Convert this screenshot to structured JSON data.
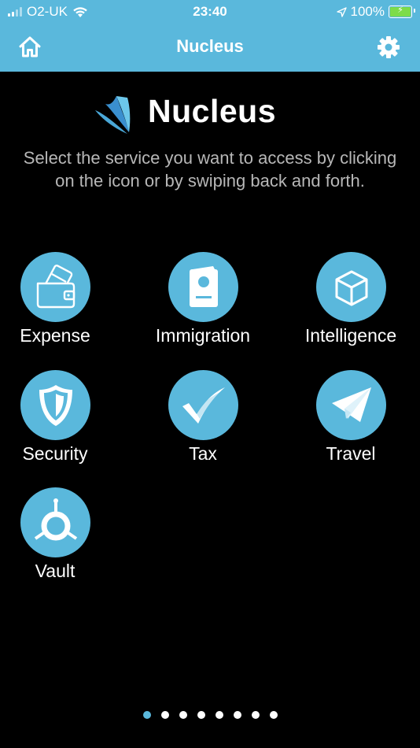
{
  "status_bar": {
    "carrier": "O2-UK",
    "time": "23:40",
    "battery": "100%"
  },
  "nav": {
    "title": "Nucleus"
  },
  "brand": {
    "name": "Nucleus"
  },
  "instructions": "Select the service you want to access by clicking on the icon or by swiping back and forth.",
  "services": [
    {
      "label": "Expense",
      "icon": "wallet-icon"
    },
    {
      "label": "Immigration",
      "icon": "passport-icon"
    },
    {
      "label": "Intelligence",
      "icon": "cube-icon"
    },
    {
      "label": "Security",
      "icon": "shield-icon"
    },
    {
      "label": "Tax",
      "icon": "checkmark-icon"
    },
    {
      "label": "Travel",
      "icon": "paper-plane-icon"
    },
    {
      "label": "Vault",
      "icon": "vault-dial-icon"
    }
  ],
  "pager": {
    "pages": 8,
    "active_index": 0
  },
  "colors": {
    "accent": "#5ab8dc",
    "background": "#000000",
    "instruction_text": "#b7b7b7",
    "battery": "#7ddc4a"
  }
}
